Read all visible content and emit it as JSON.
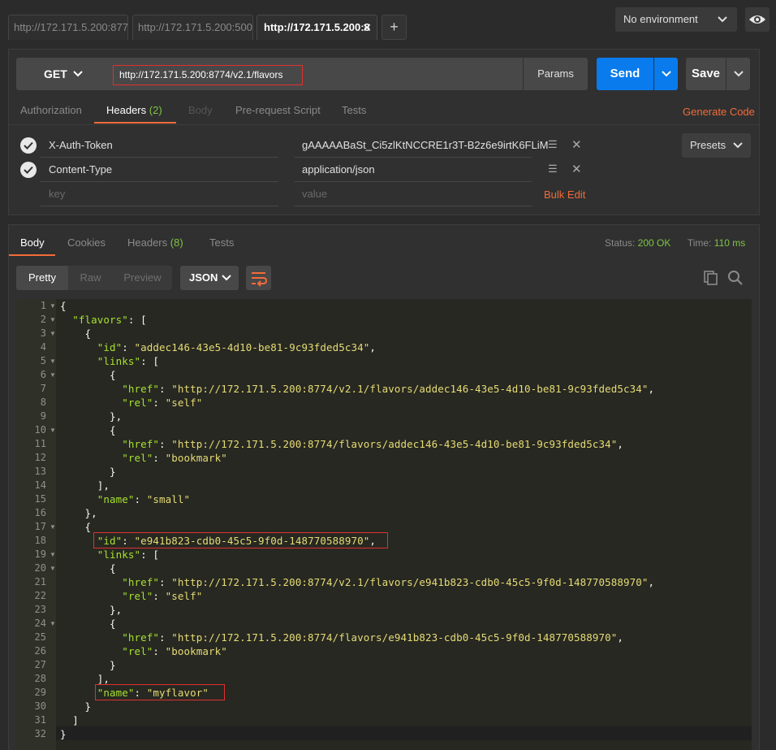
{
  "tabs": [
    {
      "label": "http://172.171.5.200:877"
    },
    {
      "label": "http://172.171.5.200:500"
    },
    {
      "label": "http://172.171.5.200:8"
    }
  ],
  "new_tab_label": "+",
  "environment": {
    "selected": "No environment"
  },
  "request": {
    "method": "GET",
    "url": "http://172.171.5.200:8774/v2.1/flavors",
    "params_label": "Params",
    "send_label": "Send",
    "save_label": "Save",
    "tabs": {
      "authorization": "Authorization",
      "headers": "Headers",
      "headers_count": "(2)",
      "body": "Body",
      "prerequest": "Pre-request Script",
      "tests": "Tests"
    },
    "generate_code": "Generate Code",
    "headers": [
      {
        "key": "X-Auth-Token",
        "value": "gAAAAABaSt_Ci5zlKtNCCRE1r3T-B2z6e9irtK6FLiM"
      },
      {
        "key": "Content-Type",
        "value": "application/json"
      }
    ],
    "key_placeholder": "key",
    "value_placeholder": "value",
    "bulk_edit": "Bulk Edit",
    "presets": "Presets"
  },
  "response": {
    "tabs": {
      "body": "Body",
      "cookies": "Cookies",
      "headers": "Headers",
      "headers_count": "(8)",
      "tests": "Tests"
    },
    "status_label": "Status:",
    "status_value": "200 OK",
    "time_label": "Time:",
    "time_value": "110 ms",
    "view_modes": [
      "Pretty",
      "Raw",
      "Preview"
    ],
    "format": "JSON",
    "lines": [
      {
        "n": "1",
        "fold": true,
        "parts": [
          [
            "pun",
            "{"
          ]
        ]
      },
      {
        "n": "2",
        "fold": true,
        "parts": [
          [
            "pun",
            "  "
          ],
          [
            "key",
            "\"flavors\""
          ],
          [
            "pun",
            ": ["
          ]
        ]
      },
      {
        "n": "3",
        "fold": true,
        "parts": [
          [
            "pun",
            "    {"
          ]
        ]
      },
      {
        "n": "4",
        "fold": false,
        "parts": [
          [
            "pun",
            "      "
          ],
          [
            "key",
            "\"id\""
          ],
          [
            "pun",
            ": "
          ],
          [
            "str",
            "\"addec146-43e5-4d10-be81-9c93fded5c34\""
          ],
          [
            "pun",
            ","
          ]
        ]
      },
      {
        "n": "5",
        "fold": true,
        "parts": [
          [
            "pun",
            "      "
          ],
          [
            "key",
            "\"links\""
          ],
          [
            "pun",
            ": ["
          ]
        ]
      },
      {
        "n": "6",
        "fold": true,
        "parts": [
          [
            "pun",
            "        {"
          ]
        ]
      },
      {
        "n": "7",
        "fold": false,
        "parts": [
          [
            "pun",
            "          "
          ],
          [
            "key",
            "\"href\""
          ],
          [
            "pun",
            ": "
          ],
          [
            "str",
            "\"http://172.171.5.200:8774/v2.1/flavors/addec146-43e5-4d10-be81-9c93fded5c34\""
          ],
          [
            "pun",
            ","
          ]
        ]
      },
      {
        "n": "8",
        "fold": false,
        "parts": [
          [
            "pun",
            "          "
          ],
          [
            "key",
            "\"rel\""
          ],
          [
            "pun",
            ": "
          ],
          [
            "str",
            "\"self\""
          ]
        ]
      },
      {
        "n": "9",
        "fold": false,
        "parts": [
          [
            "pun",
            "        },"
          ]
        ]
      },
      {
        "n": "10",
        "fold": true,
        "parts": [
          [
            "pun",
            "        {"
          ]
        ]
      },
      {
        "n": "11",
        "fold": false,
        "parts": [
          [
            "pun",
            "          "
          ],
          [
            "key",
            "\"href\""
          ],
          [
            "pun",
            ": "
          ],
          [
            "str",
            "\"http://172.171.5.200:8774/flavors/addec146-43e5-4d10-be81-9c93fded5c34\""
          ],
          [
            "pun",
            ","
          ]
        ]
      },
      {
        "n": "12",
        "fold": false,
        "parts": [
          [
            "pun",
            "          "
          ],
          [
            "key",
            "\"rel\""
          ],
          [
            "pun",
            ": "
          ],
          [
            "str",
            "\"bookmark\""
          ]
        ]
      },
      {
        "n": "13",
        "fold": false,
        "parts": [
          [
            "pun",
            "        }"
          ]
        ]
      },
      {
        "n": "14",
        "fold": false,
        "parts": [
          [
            "pun",
            "      ],"
          ]
        ]
      },
      {
        "n": "15",
        "fold": false,
        "parts": [
          [
            "pun",
            "      "
          ],
          [
            "key",
            "\"name\""
          ],
          [
            "pun",
            ": "
          ],
          [
            "str",
            "\"small\""
          ]
        ]
      },
      {
        "n": "16",
        "fold": false,
        "parts": [
          [
            "pun",
            "    },"
          ]
        ]
      },
      {
        "n": "17",
        "fold": true,
        "parts": [
          [
            "pun",
            "    {"
          ]
        ]
      },
      {
        "n": "18",
        "fold": false,
        "parts": [
          [
            "pun",
            "      "
          ],
          [
            "key",
            "\"id\""
          ],
          [
            "pun",
            ": "
          ],
          [
            "str",
            "\"e941b823-cdb0-45c5-9f0d-148770588970\""
          ],
          [
            "pun",
            ","
          ]
        ]
      },
      {
        "n": "19",
        "fold": true,
        "parts": [
          [
            "pun",
            "      "
          ],
          [
            "key",
            "\"links\""
          ],
          [
            "pun",
            ": ["
          ]
        ]
      },
      {
        "n": "20",
        "fold": true,
        "parts": [
          [
            "pun",
            "        {"
          ]
        ]
      },
      {
        "n": "21",
        "fold": false,
        "parts": [
          [
            "pun",
            "          "
          ],
          [
            "key",
            "\"href\""
          ],
          [
            "pun",
            ": "
          ],
          [
            "str",
            "\"http://172.171.5.200:8774/v2.1/flavors/e941b823-cdb0-45c5-9f0d-148770588970\""
          ],
          [
            "pun",
            ","
          ]
        ]
      },
      {
        "n": "22",
        "fold": false,
        "parts": [
          [
            "pun",
            "          "
          ],
          [
            "key",
            "\"rel\""
          ],
          [
            "pun",
            ": "
          ],
          [
            "str",
            "\"self\""
          ]
        ]
      },
      {
        "n": "23",
        "fold": false,
        "parts": [
          [
            "pun",
            "        },"
          ]
        ]
      },
      {
        "n": "24",
        "fold": true,
        "parts": [
          [
            "pun",
            "        {"
          ]
        ]
      },
      {
        "n": "25",
        "fold": false,
        "parts": [
          [
            "pun",
            "          "
          ],
          [
            "key",
            "\"href\""
          ],
          [
            "pun",
            ": "
          ],
          [
            "str",
            "\"http://172.171.5.200:8774/flavors/e941b823-cdb0-45c5-9f0d-148770588970\""
          ],
          [
            "pun",
            ","
          ]
        ]
      },
      {
        "n": "26",
        "fold": false,
        "parts": [
          [
            "pun",
            "          "
          ],
          [
            "key",
            "\"rel\""
          ],
          [
            "pun",
            ": "
          ],
          [
            "str",
            "\"bookmark\""
          ]
        ]
      },
      {
        "n": "27",
        "fold": false,
        "parts": [
          [
            "pun",
            "        }"
          ]
        ]
      },
      {
        "n": "28",
        "fold": false,
        "parts": [
          [
            "pun",
            "      ],"
          ]
        ]
      },
      {
        "n": "29",
        "fold": false,
        "parts": [
          [
            "pun",
            "      "
          ],
          [
            "key",
            "\"name\""
          ],
          [
            "pun",
            ": "
          ],
          [
            "str",
            "\"myflavor\""
          ]
        ]
      },
      {
        "n": "30",
        "fold": false,
        "parts": [
          [
            "pun",
            "    }"
          ]
        ]
      },
      {
        "n": "31",
        "fold": false,
        "parts": [
          [
            "pun",
            "  ]"
          ]
        ]
      },
      {
        "n": "32",
        "fold": false,
        "parts": [
          [
            "pun",
            "}"
          ]
        ]
      }
    ]
  },
  "colors": {
    "accent": "#f26b3a",
    "send_button": "#097bed",
    "status_ok": "#7ec543",
    "annotation_box": "#e0302f"
  },
  "icons": [
    "chevron-down-icon",
    "eye-icon",
    "close-icon",
    "plus-icon",
    "check-icon",
    "drag-handle-icon",
    "delete-icon",
    "wrap-lines-icon",
    "copy-icon",
    "search-icon"
  ]
}
